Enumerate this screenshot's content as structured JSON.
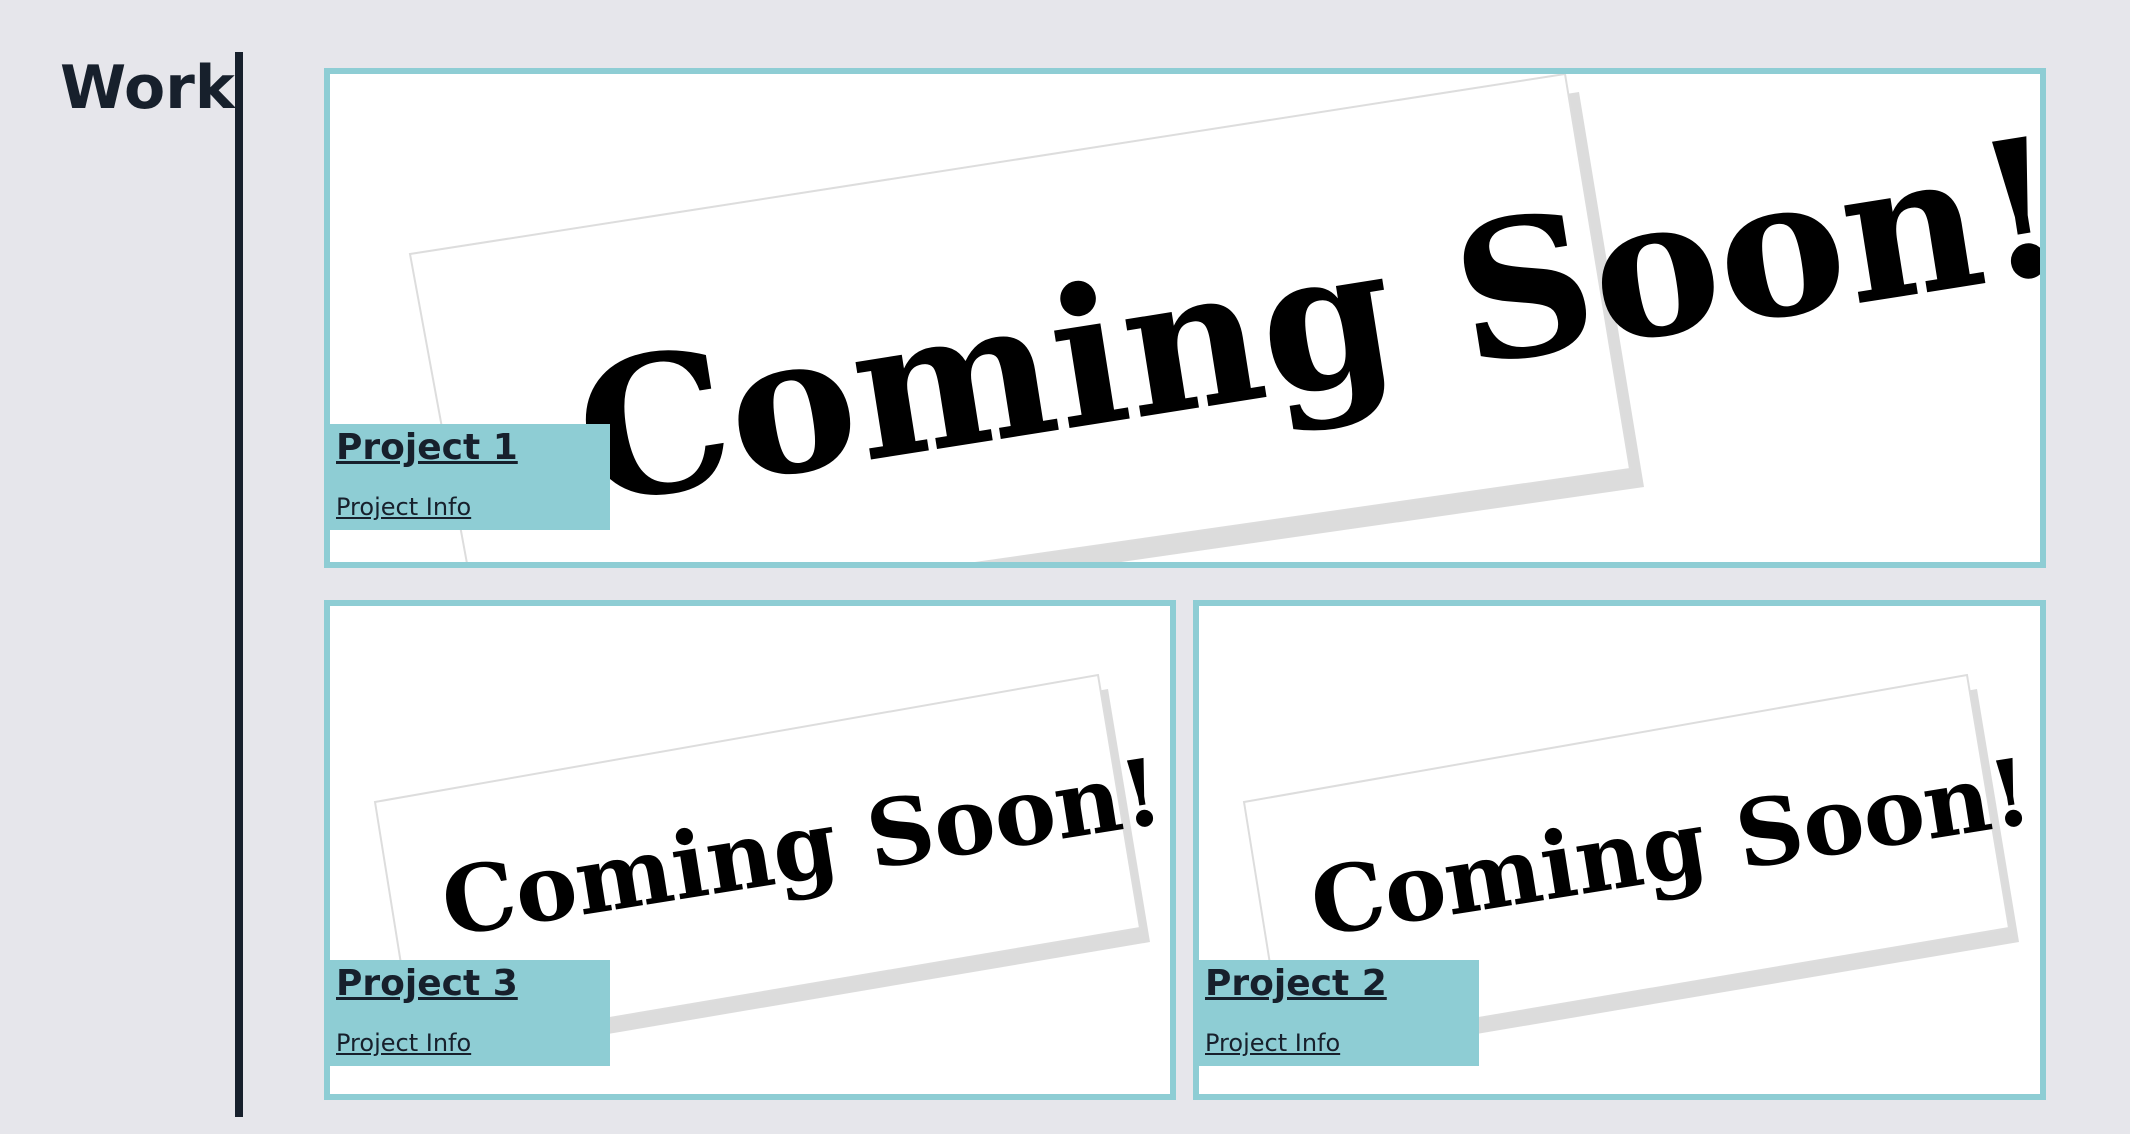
{
  "section": {
    "title": "Work"
  },
  "colors": {
    "background": "#e6e6eb",
    "accent": "#8ecdd4",
    "text": "#17202c"
  },
  "placeholder_image_text": "Coming Soon!",
  "projects": [
    {
      "title": "Project 1",
      "info_link": "Project Info"
    },
    {
      "title": "Project 3",
      "info_link": "Project Info"
    },
    {
      "title": "Project 2",
      "info_link": "Project Info"
    }
  ]
}
